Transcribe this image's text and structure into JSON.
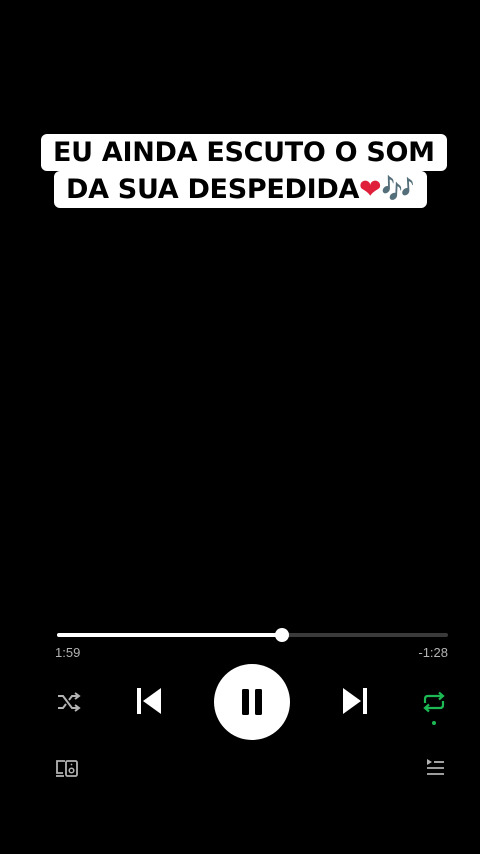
{
  "caption": {
    "line1": "EU AINDA ESCUTO O SOM",
    "line2_text": "DA SUA DESPEDIDA",
    "line2_heart": "❤",
    "line2_notes": "🎶"
  },
  "player": {
    "elapsed": "1:59",
    "remaining": "-1:28",
    "progress_fraction": 0.576,
    "is_playing": true,
    "repeat_active": true
  },
  "colors": {
    "background": "#000000",
    "accent": "#1db954",
    "track": "#3a3a3a",
    "text_secondary": "#b3b3b3"
  },
  "icons": {
    "shuffle": "shuffle-icon",
    "previous": "skip-previous-icon",
    "pause": "pause-icon",
    "next": "skip-next-icon",
    "repeat": "repeat-icon",
    "devices": "connect-devices-icon",
    "queue": "queue-icon"
  }
}
